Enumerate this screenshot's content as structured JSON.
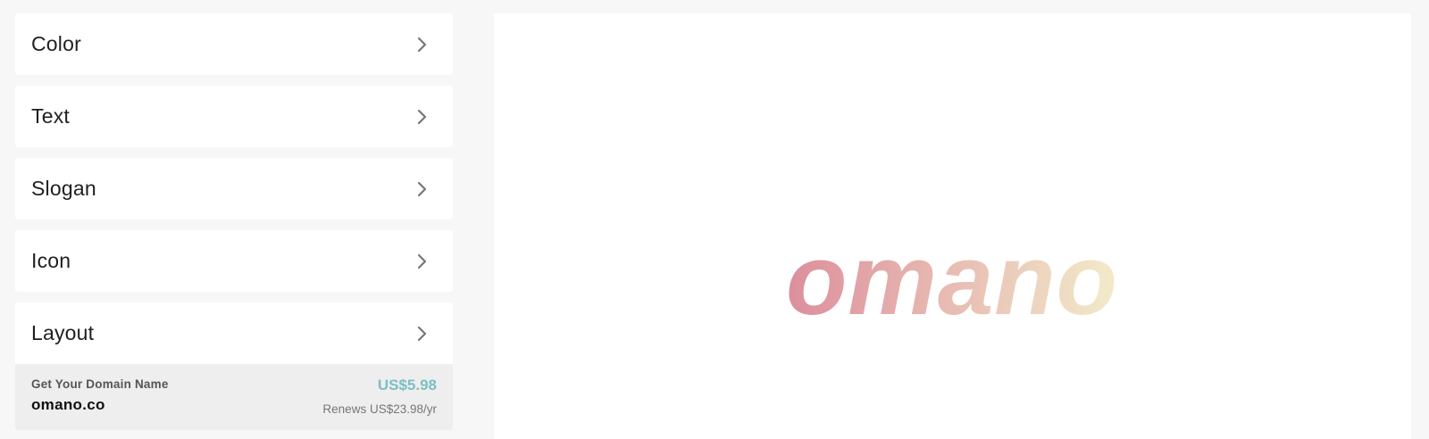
{
  "menu": {
    "items": [
      {
        "label": "Color",
        "icon": "chevron-right-icon"
      },
      {
        "label": "Text",
        "icon": "chevron-right-icon"
      },
      {
        "label": "Slogan",
        "icon": "chevron-right-icon"
      },
      {
        "label": "Icon",
        "icon": "chevron-right-icon"
      },
      {
        "label": "Layout",
        "icon": "chevron-right-icon"
      }
    ]
  },
  "domain_offer": {
    "heading": "Get Your Domain Name",
    "domain": "omano.co",
    "price": "US$5.98",
    "renewal": "Renews US$23.98/yr"
  },
  "preview": {
    "logo_text": "omano",
    "gradient_start": "#dc8e9c",
    "gradient_end": "#f3ebca"
  },
  "colors": {
    "price_accent": "#7cc0c2",
    "page_background": "#f7f7f7"
  }
}
